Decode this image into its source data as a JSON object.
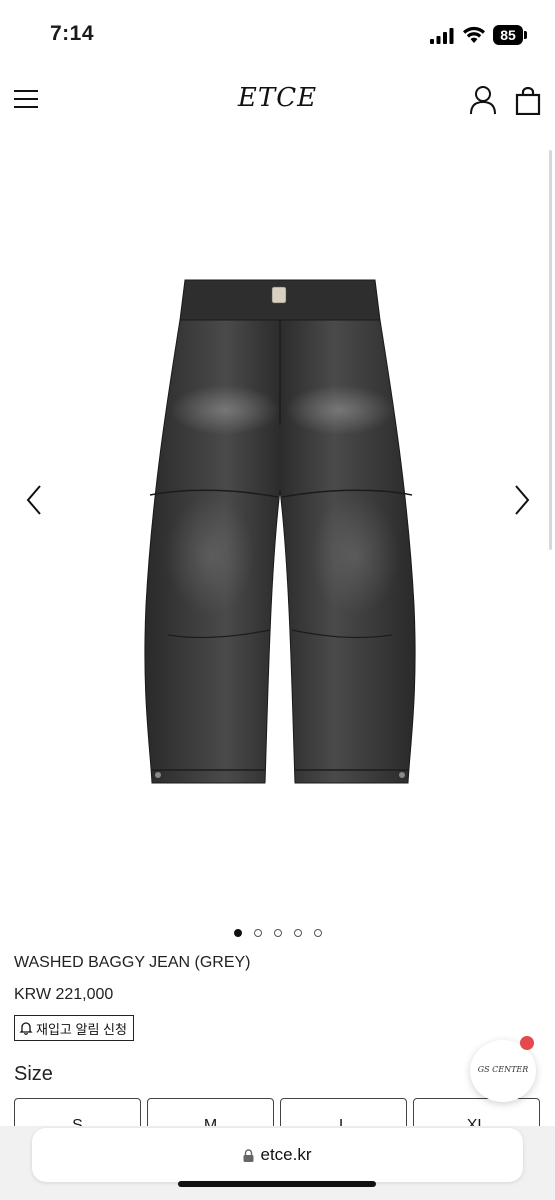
{
  "status": {
    "time": "7:14",
    "battery": "85"
  },
  "header": {
    "logo": "ETCE"
  },
  "gallery": {
    "slide_count": 5,
    "active_index": 0
  },
  "product": {
    "name": "WASHED BAGGY JEAN (GREY)",
    "price": "KRW 221,000",
    "restock_label": "재입고 알림 신청",
    "size_label": "Size",
    "sizes": [
      "S",
      "M",
      "L",
      "XL"
    ]
  },
  "chat": {
    "label": "GS CENTER"
  },
  "browser": {
    "url": "etce.kr"
  },
  "icons": {
    "menu": "hamburger-icon",
    "account": "user-icon",
    "cart": "shopping-bag-icon",
    "prev": "chevron-left-icon",
    "next": "chevron-right-icon",
    "restock": "bell-icon",
    "secure": "lock-icon"
  },
  "colors": {
    "badge": "#e5484d",
    "text": "#1a1a1a"
  }
}
